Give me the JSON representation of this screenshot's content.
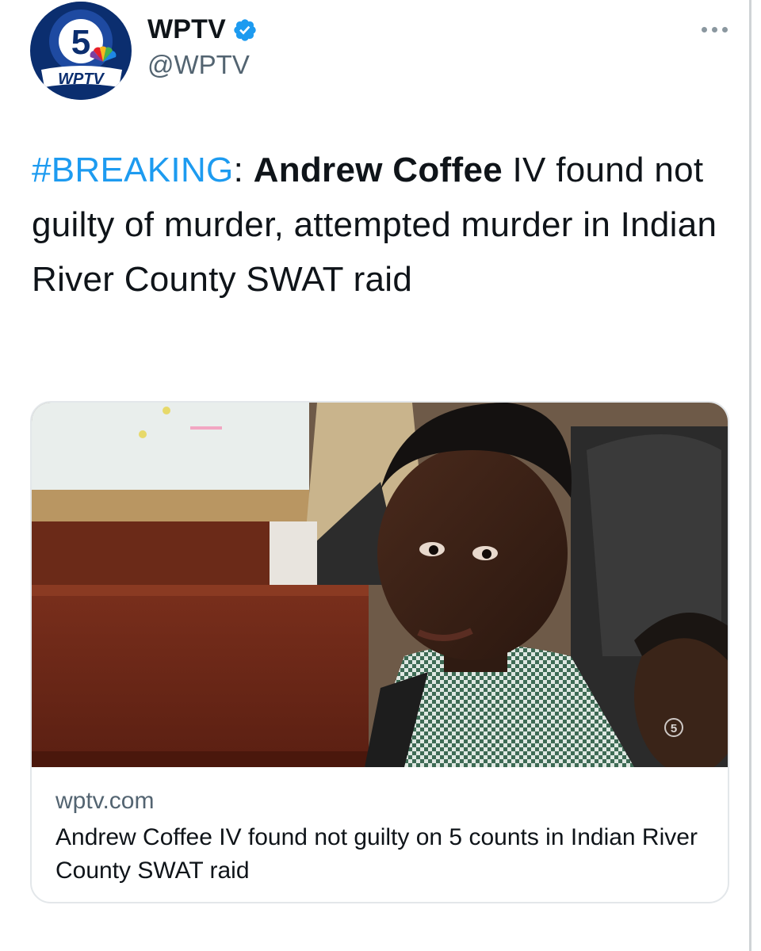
{
  "tweet": {
    "author": {
      "display_name": "WPTV",
      "handle": "@WPTV",
      "verified": true,
      "avatar": {
        "logo_number": "5",
        "logo_text": "WPTV"
      }
    },
    "text": {
      "hashtag": "#BREAKING",
      "separator": ": ",
      "name_bold": "Andrew Coffee",
      "rest": " IV found not guilty of murder, attempted murder in Indian River County SWAT raid"
    },
    "card": {
      "domain": "wptv.com",
      "title": "Andrew Coffee IV found not guilty on 5 counts in Indian River County SWAT raid",
      "image_watermark": "5"
    }
  },
  "colors": {
    "hashtag": "#1d9bf0",
    "verified": "#1d9bf0",
    "secondary_text": "#536471",
    "card_border": "#e3e7ea"
  },
  "icons": {
    "verified": "verified-badge-icon",
    "more": "more-horizontal-icon"
  }
}
